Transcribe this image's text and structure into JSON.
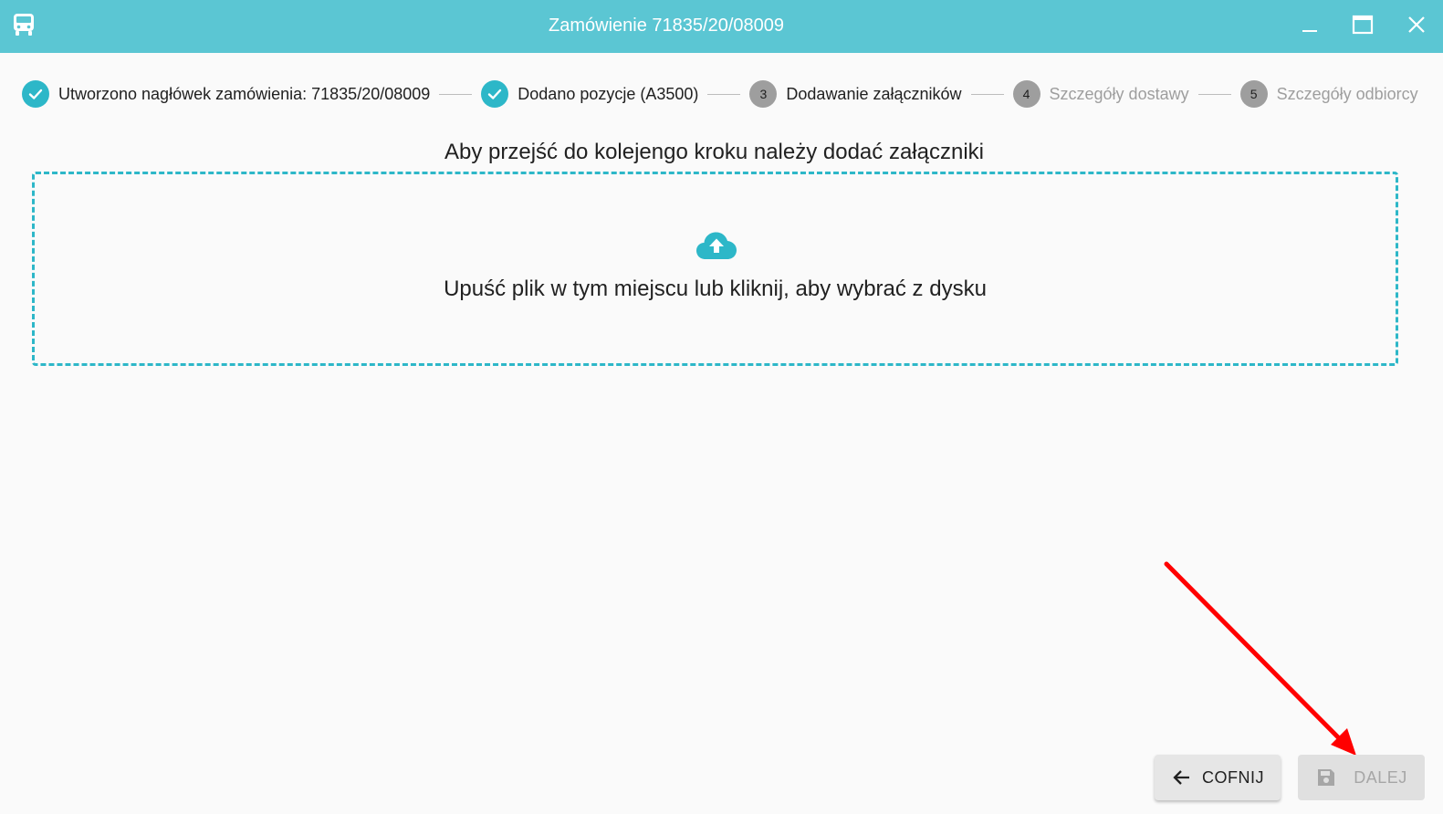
{
  "window": {
    "title": "Zamówienie 71835/20/08009",
    "app_icon": "bus-icon",
    "controls": [
      "minimize-icon",
      "maximize-icon",
      "close-icon"
    ],
    "accent_color": "#5bc6d3"
  },
  "stepper": {
    "steps": [
      {
        "label": "Utworzono nagłówek zamówienia: 71835/20/08009",
        "status": "done",
        "icon": "check-icon"
      },
      {
        "label": "Dodano pozycje (A3500)",
        "status": "done",
        "icon": "check-icon"
      },
      {
        "number": "3",
        "label": "Dodawanie załączników",
        "status": "active"
      },
      {
        "number": "4",
        "label": "Szczegóły dostawy",
        "status": "pending"
      },
      {
        "number": "5",
        "label": "Szczegóły odbiorcy",
        "status": "pending"
      }
    ],
    "done_color": "#2db7c8"
  },
  "main": {
    "heading": "Aby przejść do kolejengo kroku należy dodać załączniki",
    "dropzone": {
      "icon": "cloud-upload-icon",
      "text": "Upuść plik w tym miejscu lub kliknij, aby wybrać z dysku"
    }
  },
  "footer": {
    "back_label": "COFNIJ",
    "back_icon": "arrow-left-icon",
    "next_label": "DALEJ",
    "next_icon": "save-icon",
    "next_enabled": false
  },
  "annotation": {
    "type": "red-arrow",
    "target": "next-button",
    "color": "#ff0000"
  }
}
